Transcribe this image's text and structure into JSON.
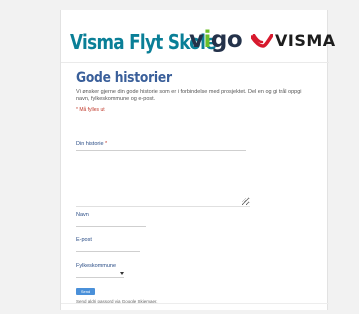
{
  "header": {
    "logo_flyt": "Visma Flyt Skole",
    "logo_vigo_v": "v",
    "logo_vigo_i": "i",
    "logo_vigo_go": "go",
    "logo_visma": "VISMA"
  },
  "form": {
    "title": "Gode historier",
    "description": "Vi ønsker gjerne din gode historie som er i forbindelse med prosjektet. Del en og gi trål oppgi navn, fylkeskommune og e-post.",
    "required_note": "* Må fylles ut",
    "fields": {
      "story_label": "Din historie",
      "name_label": "Navn",
      "email_label": "E-post",
      "county_label": "Fylkeskommune"
    },
    "required_star": " *",
    "submit_label": "Send",
    "footer_note": "Send aldri passord via Google Skjemaer."
  },
  "colors": {
    "logo_flyt": "#0a7f97",
    "vigo_main": "#24324a",
    "vigo_i": "#6cbf2a",
    "visma_red": "#d7192d",
    "title": "#3a5f9a",
    "required": "#c0392b",
    "submit": "#4a90d9"
  }
}
